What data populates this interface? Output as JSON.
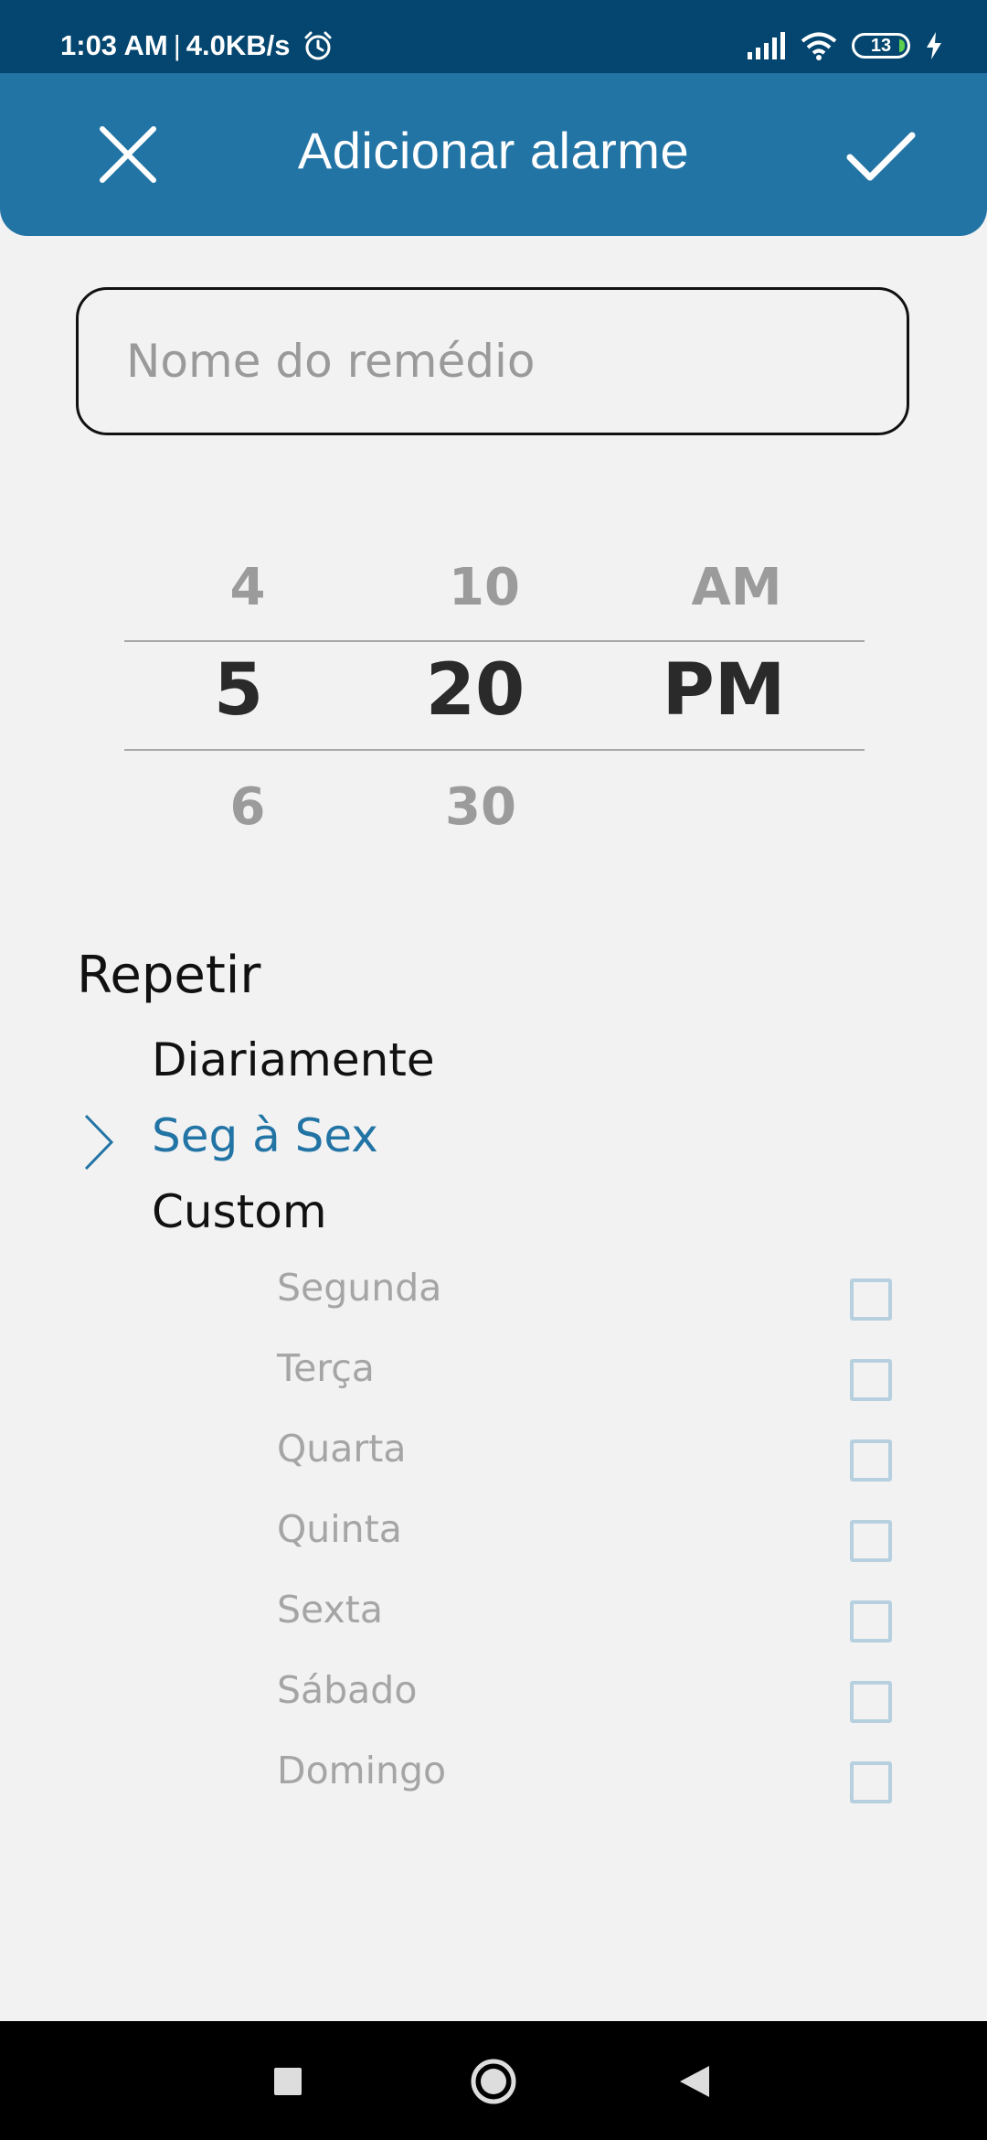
{
  "status_bar": {
    "time": "1:03 AM",
    "separator": "|",
    "net_speed": "4.0KB/s",
    "battery_level": "13",
    "icons": [
      "alarm-icon",
      "signal-icon",
      "wifi-icon",
      "battery-icon",
      "charging-icon"
    ]
  },
  "app_bar": {
    "title": "Adicionar alarme",
    "close_icon": "close-icon",
    "confirm_icon": "check-icon",
    "background": "#2274a5"
  },
  "name_field": {
    "placeholder": "Nome do remédio",
    "value": ""
  },
  "time_picker": {
    "hour": {
      "prev": "4",
      "selected": "5",
      "next": "6"
    },
    "minute": {
      "prev": "10",
      "selected": "20",
      "next": "30"
    },
    "period": {
      "prev": "AM",
      "selected": "PM",
      "next": ""
    }
  },
  "repeat": {
    "title": "Repetir",
    "options": [
      {
        "label": "Diariamente",
        "selected": false
      },
      {
        "label": "Seg à Sex",
        "selected": true
      },
      {
        "label": "Custom",
        "selected": false
      }
    ],
    "days": [
      {
        "label": "Segunda",
        "checked": false
      },
      {
        "label": "Terça",
        "checked": false
      },
      {
        "label": "Quarta",
        "checked": false
      },
      {
        "label": "Quinta",
        "checked": false
      },
      {
        "label": "Sexta",
        "checked": false
      },
      {
        "label": "Sábado",
        "checked": false
      },
      {
        "label": "Domingo",
        "checked": false
      }
    ],
    "accent_color": "#2274a5"
  },
  "nav_bar": {
    "icons": [
      "recents-square-icon",
      "home-circle-icon",
      "back-triangle-icon"
    ]
  }
}
